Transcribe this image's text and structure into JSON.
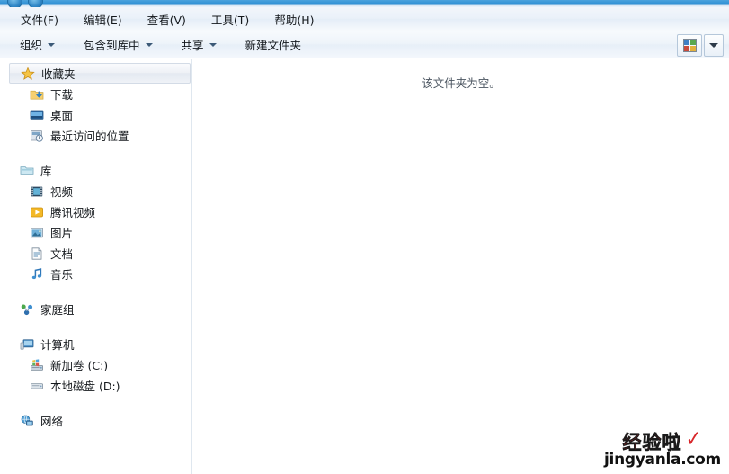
{
  "window": {
    "nav": {
      "back_label": "back-button",
      "forward_label": "forward-button"
    }
  },
  "menubar": {
    "items": [
      {
        "label": "文件(F)",
        "name": "menu-file"
      },
      {
        "label": "编辑(E)",
        "name": "menu-edit"
      },
      {
        "label": "查看(V)",
        "name": "menu-view"
      },
      {
        "label": "工具(T)",
        "name": "menu-tools"
      },
      {
        "label": "帮助(H)",
        "name": "menu-help"
      }
    ]
  },
  "toolbar": {
    "organize": "组织",
    "include_in_library": "包含到库中",
    "share": "共享",
    "new_folder": "新建文件夹",
    "view_icon": "view-grid-icon",
    "view_caret_icon": "chevron-down-icon"
  },
  "sidebar": {
    "sections": [
      {
        "name": "favorites",
        "header": {
          "label": "收藏夹",
          "icon": "star-icon",
          "selected": true
        },
        "items": [
          {
            "label": "下载",
            "icon": "downloads-folder-icon"
          },
          {
            "label": "桌面",
            "icon": "desktop-icon"
          },
          {
            "label": "最近访问的位置",
            "icon": "recent-places-icon"
          }
        ]
      },
      {
        "name": "libraries",
        "header": {
          "label": "库",
          "icon": "library-folder-icon",
          "selected": false
        },
        "items": [
          {
            "label": "视频",
            "icon": "video-film-icon"
          },
          {
            "label": "腾讯视频",
            "icon": "tencent-video-icon"
          },
          {
            "label": "图片",
            "icon": "pictures-icon"
          },
          {
            "label": "文档",
            "icon": "documents-icon"
          },
          {
            "label": "音乐",
            "icon": "music-note-icon"
          }
        ]
      },
      {
        "name": "homegroup",
        "header": {
          "label": "家庭组",
          "icon": "homegroup-icon",
          "selected": false
        },
        "items": []
      },
      {
        "name": "computer",
        "header": {
          "label": "计算机",
          "icon": "computer-icon",
          "selected": false
        },
        "items": [
          {
            "label": "新加卷 (C:)",
            "icon": "system-drive-icon"
          },
          {
            "label": "本地磁盘 (D:)",
            "icon": "hard-drive-icon"
          }
        ]
      },
      {
        "name": "network",
        "header": {
          "label": "网络",
          "icon": "network-icon",
          "selected": false
        },
        "items": []
      }
    ]
  },
  "content": {
    "empty_message": "该文件夹为空。"
  },
  "watermark": {
    "chinese": "经验啦",
    "check": "✓",
    "url": "jingyanla.com",
    "color": "#d8262a"
  }
}
